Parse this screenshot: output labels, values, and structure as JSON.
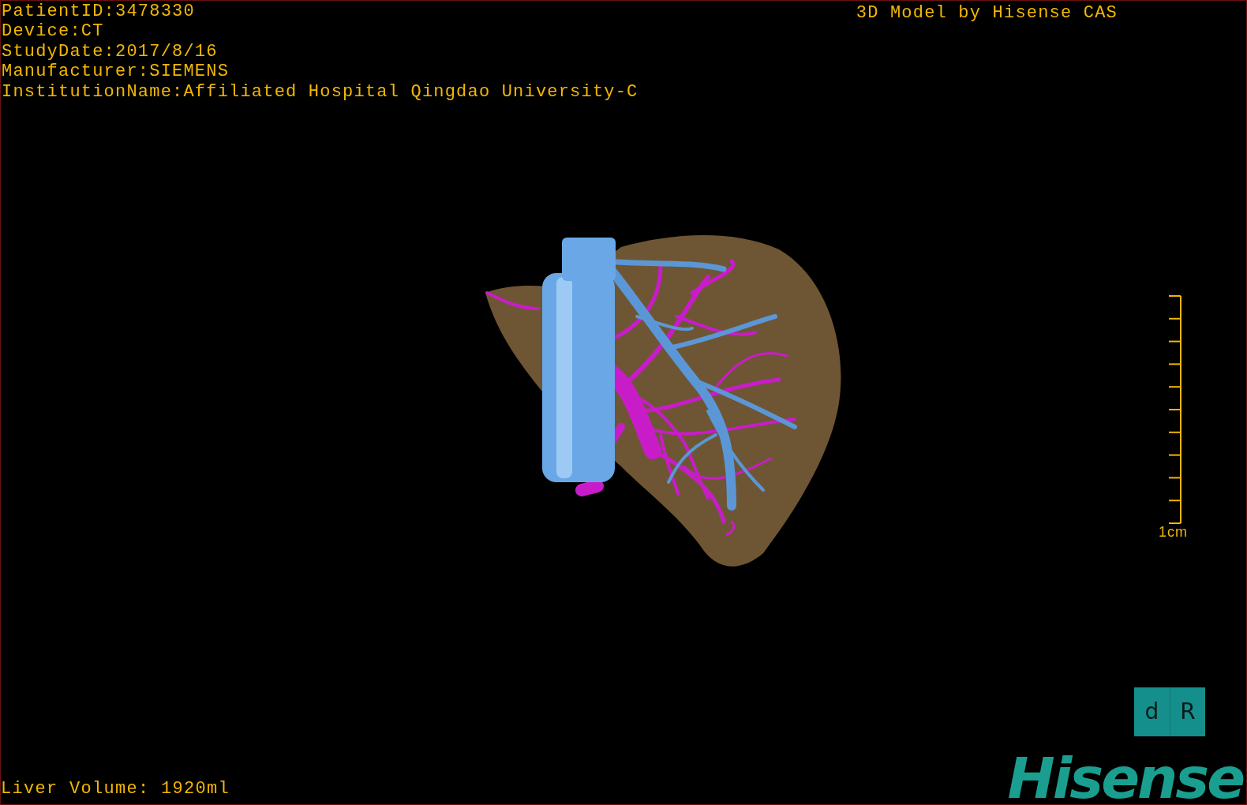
{
  "study_info": [
    "PatientID:3478330",
    "Device:CT",
    "StudyDate:2017/8/16",
    "Manufacturer:SIEMENS",
    "InstitutionName:Affiliated Hospital Qingdao University-C"
  ],
  "model_title": "3D Model by Hisense CAS",
  "scale_bar": {
    "label": "1cm"
  },
  "orientation_cube": {
    "faces": [
      "d",
      "R"
    ]
  },
  "liver_volume": "Liver Volume: 1920ml",
  "logo": "Hisense"
}
